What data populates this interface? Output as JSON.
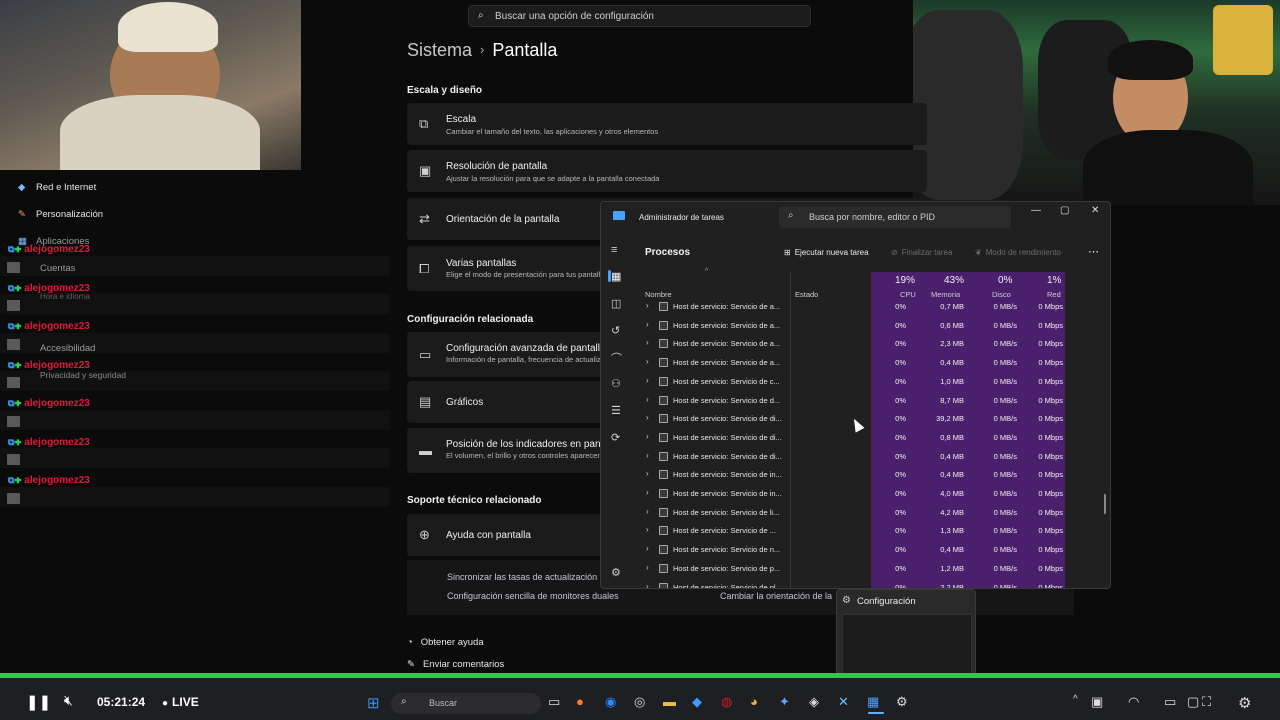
{
  "settings": {
    "search_placeholder": "Buscar una opción de configuración",
    "breadcrumb": {
      "parent": "Sistema",
      "current": "Pantalla"
    },
    "section_scale": "Escala y diseño",
    "cards": [
      {
        "title": "Escala",
        "subtitle": "Cambiar el tamaño del texto, las aplicaciones y otros elementos"
      },
      {
        "title": "Resolución de pantalla",
        "subtitle": "Ajustar la resolución para que se adapte a la pantalla conectada"
      },
      {
        "title": "Orientación de la pantalla",
        "subtitle": ""
      },
      {
        "title": "Varias pantallas",
        "subtitle": "Elige el modo de presentación para tus pantallas"
      }
    ],
    "section_related": "Configuración relacionada",
    "related": [
      {
        "title": "Configuración avanzada de pantalla",
        "subtitle": "Información de pantalla, frecuencia de actualización"
      },
      {
        "title": "Gráficos",
        "subtitle": ""
      },
      {
        "title": "Posición de los indicadores en pantalla",
        "subtitle": "El volumen, el brillo y otros controles aparecen"
      }
    ],
    "section_support": "Soporte técnico relacionado",
    "help_card": "Ayuda con pantalla",
    "help_links": [
      "Sincronizar las tasas de actualización",
      "Configuración sencilla de monitores duales",
      "Cambiar la orientación de la"
    ],
    "footer_links": [
      "Obtener ayuda",
      "Enviar comentarios"
    ],
    "sidebar": [
      "Red e Internet",
      "Personalización",
      "Aplicaciones",
      "Cuentas",
      "Hora e idioma",
      "Accesibilidad",
      "Privacidad y seguridad"
    ]
  },
  "chat": {
    "username": "alejogomez23",
    "line_count": 7
  },
  "task_manager": {
    "title": "Administrador de tareas",
    "search_placeholder": "Busca por nombre, editor o PID",
    "section": "Procesos",
    "buttons": {
      "new_task": "Ejecutar nueva tarea",
      "end_task": "Finalizar tarea",
      "efficiency": "Modo de rendimiento"
    },
    "columns": {
      "name": "Nombre",
      "status": "Estado",
      "cpu_pct": "19%",
      "cpu": "CPU",
      "mem_pct": "43%",
      "mem": "Memoria",
      "disk_pct": "0%",
      "disk": "Disco",
      "net_pct": "1%",
      "net": "Red"
    },
    "rows": [
      {
        "name": "Host de servicio: Servicio de a...",
        "cpu": "0%",
        "mem": "0,7 MB",
        "disk": "0 MB/s",
        "net": "0 Mbps"
      },
      {
        "name": "Host de servicio: Servicio de a...",
        "cpu": "0%",
        "mem": "0,6 MB",
        "disk": "0 MB/s",
        "net": "0 Mbps"
      },
      {
        "name": "Host de servicio: Servicio de a...",
        "cpu": "0%",
        "mem": "2,3 MB",
        "disk": "0 MB/s",
        "net": "0 Mbps"
      },
      {
        "name": "Host de servicio: Servicio de a...",
        "cpu": "0%",
        "mem": "0,4 MB",
        "disk": "0 MB/s",
        "net": "0 Mbps"
      },
      {
        "name": "Host de servicio: Servicio de c...",
        "cpu": "0%",
        "mem": "1,0 MB",
        "disk": "0 MB/s",
        "net": "0 Mbps"
      },
      {
        "name": "Host de servicio: Servicio de d...",
        "cpu": "0%",
        "mem": "8,7 MB",
        "disk": "0 MB/s",
        "net": "0 Mbps"
      },
      {
        "name": "Host de servicio: Servicio de di...",
        "cpu": "0%",
        "mem": "39,2 MB",
        "disk": "0 MB/s",
        "net": "0 Mbps"
      },
      {
        "name": "Host de servicio: Servicio de di...",
        "cpu": "0%",
        "mem": "0,8 MB",
        "disk": "0 MB/s",
        "net": "0 Mbps"
      },
      {
        "name": "Host de servicio: Servicio de di...",
        "cpu": "0%",
        "mem": "0,4 MB",
        "disk": "0 MB/s",
        "net": "0 Mbps"
      },
      {
        "name": "Host de servicio: Servicio de in...",
        "cpu": "0%",
        "mem": "0,4 MB",
        "disk": "0 MB/s",
        "net": "0 Mbps"
      },
      {
        "name": "Host de servicio: Servicio de in...",
        "cpu": "0%",
        "mem": "4,0 MB",
        "disk": "0 MB/s",
        "net": "0 Mbps"
      },
      {
        "name": "Host de servicio: Servicio de li...",
        "cpu": "0%",
        "mem": "4,2 MB",
        "disk": "0 MB/s",
        "net": "0 Mbps"
      },
      {
        "name": "Host de servicio: Servicio de ...",
        "cpu": "0%",
        "mem": "1,3 MB",
        "disk": "0 MB/s",
        "net": "0 Mbps"
      },
      {
        "name": "Host de servicio: Servicio de n...",
        "cpu": "0%",
        "mem": "0,4 MB",
        "disk": "0 MB/s",
        "net": "0 Mbps"
      },
      {
        "name": "Host de servicio: Servicio de p...",
        "cpu": "0%",
        "mem": "1,2 MB",
        "disk": "0 MB/s",
        "net": "0 Mbps"
      },
      {
        "name": "Host de servicio: Servicio de pl...",
        "cpu": "0%",
        "mem": "2,2 MB",
        "disk": "0 MB/s",
        "net": "0 Mbps"
      }
    ]
  },
  "popup": {
    "title": "Configuración"
  },
  "stream": {
    "time": "05:21:24",
    "live": "LIVE"
  },
  "taskbar": {
    "search": "Buscar"
  }
}
